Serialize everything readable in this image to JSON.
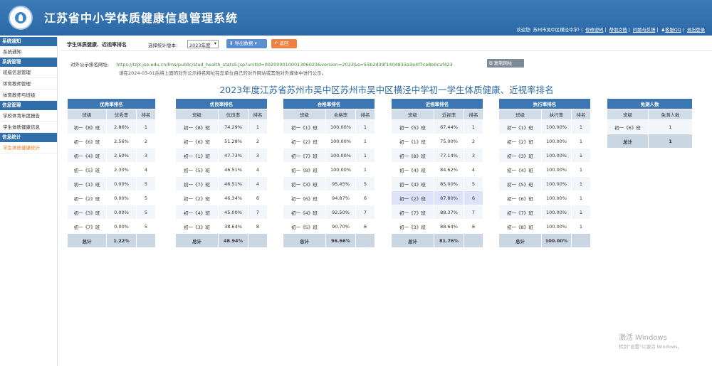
{
  "app": {
    "title": "江苏省中小学体质健康信息管理系统"
  },
  "userbar": {
    "welcome": "欢迎您: 苏州市吴中区横泾中学!",
    "links": [
      "修改密码",
      "帮助文档",
      "问题与反馈",
      "客服QQ",
      "退出登录"
    ]
  },
  "sidebar": {
    "groups": [
      {
        "title": "系统通知",
        "items": [
          "系统通知"
        ]
      },
      {
        "title": "系统管理",
        "items": [
          "班级信息管理",
          "体育教师管理",
          "体育教师与班级"
        ]
      },
      {
        "title": "信息管理",
        "items": [
          "学校体育年度报告",
          "学生体质健康信息"
        ]
      },
      {
        "title": "信息统计",
        "items": [
          "学生体质健康统计"
        ]
      }
    ],
    "active": "学生体质健康统计"
  },
  "toolbar": {
    "page_title": "学生体质健康、近视率排名",
    "version_label": "选择统计版本:",
    "version_value": "2023年度",
    "export_label": "导出数据",
    "back_label": "返回"
  },
  "public_url": {
    "label": "对外公示排名网址:",
    "url": "https://tzjk.jse.edu.cn/fms/public/stud_health_stats5.jsp?unitId=002000010001306023&version=2023&s=55b2d39f1404833a3e4f7ce8e0caf423",
    "copy_label": "复制网址",
    "notice": "请在2024-03-01后将上面的对外公示排名网址在您单位自己的对外网站或其他对外媒体中进行公示。"
  },
  "report_title": "2023年度江苏省苏州市吴中区苏州市吴中区横泾中学初一学生体质健康、近视率排名",
  "tables": [
    {
      "title": "优秀率排名",
      "cols": [
        "班级",
        "优秀率",
        "排名"
      ],
      "rows": [
        [
          "初一《8》班",
          "2.86%",
          "1"
        ],
        [
          "初一《6》班",
          "2.56%",
          "2"
        ],
        [
          "初一《4》班",
          "2.50%",
          "3"
        ],
        [
          "初一《5》班",
          "2.33%",
          "4"
        ],
        [
          "初一《1》班",
          "0.00%",
          "5"
        ],
        [
          "初一《2》班",
          "0.00%",
          "5"
        ],
        [
          "初一《3》班",
          "0.00%",
          "5"
        ],
        [
          "初一《7》班",
          "0.00%",
          "5"
        ]
      ],
      "total": [
        "总计",
        "1.22%",
        ""
      ]
    },
    {
      "title": "优良率排名",
      "cols": [
        "班级",
        "优良率",
        "排名"
      ],
      "rows": [
        [
          "初一《8》班",
          "74.29%",
          "1"
        ],
        [
          "初一《6》班",
          "51.28%",
          "2"
        ],
        [
          "初一《1》班",
          "47.73%",
          "3"
        ],
        [
          "初一《5》班",
          "46.51%",
          "4"
        ],
        [
          "初一《7》班",
          "46.51%",
          "4"
        ],
        [
          "初一《2》班",
          "46.34%",
          "6"
        ],
        [
          "初一《4》班",
          "45.00%",
          "7"
        ],
        [
          "初一《3》班",
          "38.64%",
          "8"
        ]
      ],
      "total": [
        "总计",
        "48.94%",
        ""
      ]
    },
    {
      "title": "合格率排名",
      "cols": [
        "班级",
        "合格率",
        "排名"
      ],
      "rows": [
        [
          "初一《1》班",
          "100.00%",
          "1"
        ],
        [
          "初一《2》班",
          "100.00%",
          "1"
        ],
        [
          "初一《7》班",
          "100.00%",
          "1"
        ],
        [
          "初一《8》班",
          "100.00%",
          "1"
        ],
        [
          "初一《3》班",
          "95.45%",
          "5"
        ],
        [
          "初一《6》班",
          "94.87%",
          "6"
        ],
        [
          "初一《4》班",
          "92.50%",
          "7"
        ],
        [
          "初一《5》班",
          "90.70%",
          "8"
        ]
      ],
      "total": [
        "总计",
        "96.66%",
        ""
      ]
    },
    {
      "title": "近视率排名",
      "cols": [
        "班级",
        "近视率",
        "排名"
      ],
      "rows": [
        [
          "初一《5》班",
          "67.44%",
          "1"
        ],
        [
          "初一《1》班",
          "75.00%",
          "2"
        ],
        [
          "初一《8》班",
          "77.14%",
          "3"
        ],
        [
          "初一《4》班",
          "84.62%",
          "4"
        ],
        [
          "初一《4》班",
          "85.00%",
          "5"
        ],
        [
          "初一《2》班",
          "87.80%",
          "6"
        ],
        [
          "初一《7》班",
          "88.37%",
          "7"
        ],
        [
          "初一《3》班",
          "88.64%",
          "8"
        ]
      ],
      "total": [
        "总计",
        "81.76%",
        ""
      ]
    },
    {
      "title": "执行率排名",
      "cols": [
        "班级",
        "执行率",
        "排名"
      ],
      "rows": [
        [
          "初一《1》班",
          "100.00%",
          "1"
        ],
        [
          "初一《2》班",
          "100.00%",
          "1"
        ],
        [
          "初一《3》班",
          "100.00%",
          "1"
        ],
        [
          "初一《4》班",
          "100.00%",
          "1"
        ],
        [
          "初一《5》班",
          "100.00%",
          "1"
        ],
        [
          "初一《6》班",
          "100.00%",
          "1"
        ],
        [
          "初一《7》班",
          "100.00%",
          "1"
        ],
        [
          "初一《8》班",
          "100.00%",
          "1"
        ]
      ],
      "total": [
        "总计",
        "100.00%",
        ""
      ]
    },
    {
      "title": "免测人数",
      "cols": [
        "班级",
        "免测人数"
      ],
      "rows": [
        [
          "初一《6》班",
          "1"
        ]
      ],
      "total": [
        "总计",
        "1"
      ]
    }
  ],
  "watermark": {
    "line1": "激活 Windows",
    "line2": "转到\"设置\"以激活 Windows。"
  },
  "colors": {
    "header": "#2f6ea9",
    "accent_orange": "#f07a20",
    "table_header": "#3c76b3"
  }
}
